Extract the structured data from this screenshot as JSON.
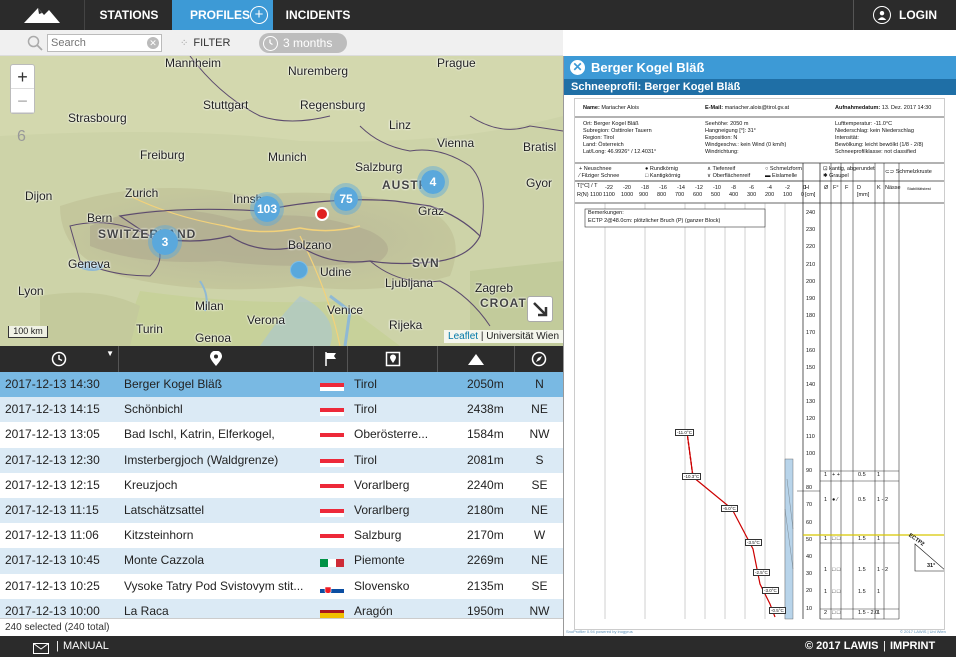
{
  "nav": {
    "tabs": [
      {
        "label": "STATIONS",
        "active": false
      },
      {
        "label": "PROFILES",
        "active": true
      },
      {
        "label": "INCIDENTS",
        "active": false
      }
    ],
    "login_label": "LOGIN"
  },
  "filterbar": {
    "search_placeholder": "Search",
    "filter_label": "FILTER",
    "range_label": "3 months"
  },
  "map": {
    "zoom_in": "+",
    "zoom_out": "−",
    "zoom_level": "6",
    "scale": "100 km",
    "attribution_link": "Leaflet",
    "attribution_text": " | Universität Wien",
    "labels": [
      {
        "text": "Mannheim",
        "bold": false
      },
      {
        "text": "Nuremberg",
        "bold": false
      },
      {
        "text": "Prague",
        "bold": false
      },
      {
        "text": "Stuttgart",
        "bold": false
      },
      {
        "text": "Regensburg",
        "bold": false
      },
      {
        "text": "Linz",
        "bold": false
      },
      {
        "text": "Strasbourg",
        "bold": false
      },
      {
        "text": "Vienna",
        "bold": false
      },
      {
        "text": "Bratisl",
        "bold": false
      },
      {
        "text": "Freiburg",
        "bold": false
      },
      {
        "text": "Munich",
        "bold": false
      },
      {
        "text": "Salzburg",
        "bold": false
      },
      {
        "text": "Zurich",
        "bold": false
      },
      {
        "text": "Innsb",
        "bold": false
      },
      {
        "text": "Gyor",
        "bold": false
      },
      {
        "text": "Dijon",
        "bold": false
      },
      {
        "text": "Bern",
        "bold": false
      },
      {
        "text": "Graz",
        "bold": false
      },
      {
        "text": "SWITZERLAND",
        "bold": true
      },
      {
        "text": "AUSTRIA",
        "bold": true
      },
      {
        "text": "Bolzano",
        "bold": false
      },
      {
        "text": "Geneva",
        "bold": false
      },
      {
        "text": "Udine",
        "bold": false
      },
      {
        "text": "Ljubljana",
        "bold": false
      },
      {
        "text": "SVN",
        "bold": true
      },
      {
        "text": "Zagreb",
        "bold": false
      },
      {
        "text": "CROAT",
        "bold": true
      },
      {
        "text": "Lyon",
        "bold": false
      },
      {
        "text": "Milan",
        "bold": false
      },
      {
        "text": "Verona",
        "bold": false
      },
      {
        "text": "Venice",
        "bold": false
      },
      {
        "text": "Rijeka",
        "bold": false
      },
      {
        "text": "Turin",
        "bold": false
      },
      {
        "text": "Genoa",
        "bold": false
      }
    ],
    "clusters": [
      {
        "count": "103"
      },
      {
        "count": "75"
      },
      {
        "count": "4"
      },
      {
        "count": "3"
      }
    ]
  },
  "table": {
    "columns": [
      "time",
      "location",
      "country",
      "region",
      "elevation",
      "aspect"
    ],
    "rows": [
      {
        "date": "2017-12-13 14:30",
        "name": "Berger Kogel Bläß",
        "flag": "AT",
        "region": "Tirol",
        "elevation": "2050m",
        "aspect": "N",
        "selected": true
      },
      {
        "date": "2017-12-13 14:15",
        "name": "Schönbichl",
        "flag": "AT",
        "region": "Tirol",
        "elevation": "2438m",
        "aspect": "NE"
      },
      {
        "date": "2017-12-13 13:05",
        "name": "Bad Ischl, Katrin, Elferkogel,",
        "flag": "AT",
        "region": "Oberösterre...",
        "elevation": "1584m",
        "aspect": "NW"
      },
      {
        "date": "2017-12-13 12:30",
        "name": "Imsterbergjoch (Waldgrenze)",
        "flag": "AT",
        "region": "Tirol",
        "elevation": "2081m",
        "aspect": "S"
      },
      {
        "date": "2017-12-13 12:15",
        "name": "Kreuzjoch",
        "flag": "AT",
        "region": "Vorarlberg",
        "elevation": "2240m",
        "aspect": "SE"
      },
      {
        "date": "2017-12-13 11:15",
        "name": "Latschätzsattel",
        "flag": "AT",
        "region": "Vorarlberg",
        "elevation": "2180m",
        "aspect": "NE"
      },
      {
        "date": "2017-12-13 11:06",
        "name": "Kitzsteinhorn",
        "flag": "AT",
        "region": "Salzburg",
        "elevation": "2170m",
        "aspect": "W"
      },
      {
        "date": "2017-12-13 10:45",
        "name": "Monte Cazzola",
        "flag": "IT",
        "region": "Piemonte",
        "elevation": "2269m",
        "aspect": "NE"
      },
      {
        "date": "2017-12-13 10:25",
        "name": "Vysoke Tatry Pod Svistovym stit...",
        "flag": "SK",
        "region": "Slovensko",
        "elevation": "2135m",
        "aspect": "SE"
      },
      {
        "date": "2017-12-13 10:00",
        "name": "La Raca",
        "flag": "ES",
        "region": "Aragón",
        "elevation": "1950m",
        "aspect": "NW"
      }
    ],
    "status": "240 selected (240 total)"
  },
  "panel": {
    "title": "Berger Kogel Bläß",
    "subtitle": "Schneeprofil: Berger Kogel Bläß",
    "doc": {
      "name_label": "Name:",
      "name_value": "Mariacher Alois",
      "email_label": "E-Mail:",
      "email_value": "mariacher.alois@tirol.gv.at",
      "date_label": "Aufnahmedatum:",
      "date_value": "13. Dez. 2017 14:30",
      "ort": "Ort: Berger Kogel Bläß",
      "subregion": "Subregion: Osttiroler Tauern",
      "region": "Region: Tirol",
      "land": "Land: Österreich",
      "latlong": "Lat/Long: 46.9926° / 12.4031°",
      "seehoehe": "Seehöhe: 2050 m",
      "hangneigung": "Hangneigung [°]: 31°",
      "exposition": "Exposition: N",
      "windgeschw": "Windgeschw.: kein Wind (0 km/h)",
      "windrichtung": "Windrichtung:",
      "lufttemp": "Lufttemperatur: -11.0°C",
      "niederschlag": "Niederschlag: kein Niederschlag",
      "intensitaet": "Intensität:",
      "bewoelkung": "Bewölkung: leicht bewölkt (1/8 - 2/8)",
      "klasse": "Schneeprofilklasse: not classified",
      "legend": [
        "Neuschnee",
        "Filziger Schnee",
        "Rundkörnig",
        "Kantigkörnig",
        "Tiefenreif",
        "Oberflächenreif",
        "Schmelzform",
        "Eislamelle",
        "kantig, abgerundet",
        "Graupel",
        "Schmelzkruste"
      ],
      "bemerkungen_label": "Bemerkungen:",
      "bemerkungen_text": "ECTP 2@48.0cm: plötzlicher Bruch (P) (ganzer Block)",
      "temps": [
        "-11.0°C",
        "-10.3°C",
        "-6.0°C",
        "-3.5°C",
        "-2.5°C",
        "-3.0°C",
        "-0.5°C"
      ],
      "depth_ticks": [
        "240",
        "230",
        "220",
        "210",
        "200",
        "190",
        "180",
        "170",
        "160",
        "150",
        "140",
        "130",
        "120",
        "110",
        "100",
        "90",
        "80",
        "70",
        "60",
        "50",
        "40",
        "30",
        "20",
        "10"
      ],
      "t_ticks": [
        "-22",
        "-20",
        "-18",
        "-16",
        "-14",
        "-12",
        "-10",
        "-8",
        "-6",
        "-4",
        "-2",
        "0"
      ],
      "r_ticks": [
        "1100",
        "1000",
        "900",
        "800",
        "700",
        "600",
        "500",
        "400",
        "300",
        "200",
        "100",
        "0"
      ],
      "t_axis_label": "T[°C] / T",
      "r_axis_label": "R(N) 1100",
      "col_h": "H [cm]",
      "col_oe": "Ø",
      "col_f1": "F°",
      "col_f2": "F",
      "col_d": "D [mm]",
      "col_k": "K",
      "col_n": "Nässe",
      "col_s": "Stabilitätstest",
      "layer_rows": [
        {
          "n": "1",
          "sym": "+ +",
          "d": "0.5",
          "k": "1"
        },
        {
          "n": "1",
          "sym": "● ⁄",
          "d": "0.5",
          "k": "1 - 2"
        },
        {
          "n": "1",
          "sym": "□ □",
          "d": "1.5",
          "k": "1"
        },
        {
          "n": "1",
          "sym": "□ □",
          "d": "1.5",
          "k": "1 - 2"
        },
        {
          "n": "1",
          "sym": "□ □",
          "d": "1.5",
          "k": "1"
        },
        {
          "n": "2",
          "sym": "□ □",
          "d": "1.5 - 2.0",
          "k": "1"
        }
      ],
      "ectp_label": "ECTP2",
      "slope": "31°",
      "footer_left": "SnoProfiler 0.94 powered by inogyrus",
      "footer_right": "© 2017 LAWIS | Uni Wien"
    }
  },
  "footer": {
    "manual": "MANUAL",
    "copyright": "© 2017 LAWIS",
    "imprint": "IMPRINT"
  },
  "colors": {
    "accent": "#3d9ad6",
    "nav": "#2b2b2b",
    "selected_row": "#79b9e3",
    "row_alt": "#dbeaf5",
    "cluster": "#5aa8dc"
  }
}
